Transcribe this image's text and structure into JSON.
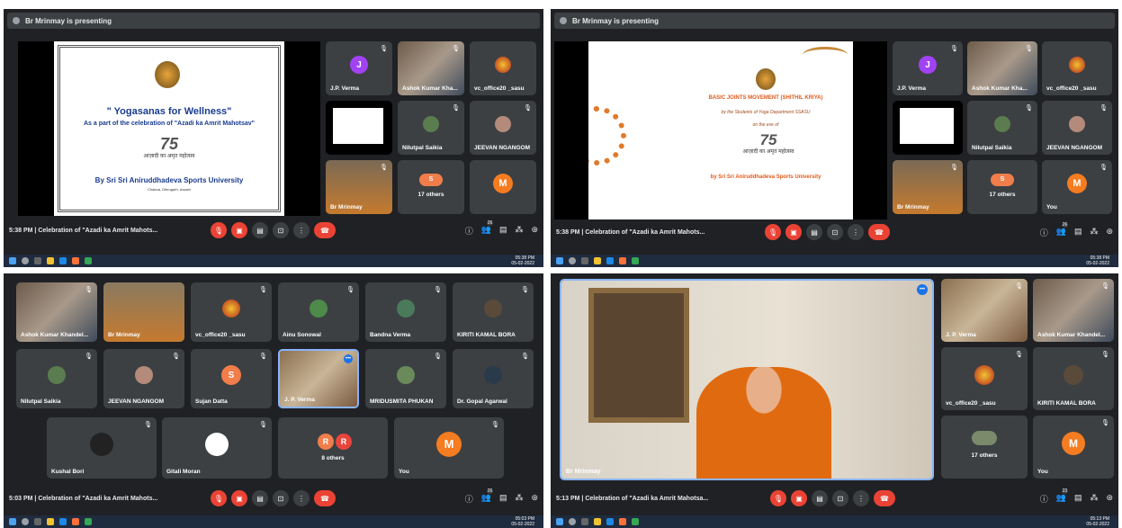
{
  "panel_a": {
    "presenting": "Br Mrinmay is presenting",
    "slide": {
      "title": "\" Yogasanas for Wellness\"",
      "subtitle": "As a part of the celebration of \"Azadi ka Amrit Mahotsav\"",
      "logo_num": "75",
      "hindi": "आज़ादी का अमृत महोत्सव",
      "org": "By Sri Sri Aniruddhadeva Sports University",
      "place": "Chabua, Dibrugarh, Assam"
    },
    "tiles": [
      "J.P. Verma",
      "Ashok Kumar Kha...",
      "vc_office20 _sasu",
      "Nilutpal Saikia",
      "JEEVAN NGANGOM",
      "Br Mrinmay",
      "17 others",
      ""
    ],
    "avatar_j": "J",
    "avatar_m": "M",
    "avatar_s": "S",
    "time": "5:38 PM",
    "meeting": "Celebration of \"Azadi ka Amrit Mahots...",
    "count": "26",
    "clock_time": "05:38 PM",
    "clock_date": "05-02-2022"
  },
  "panel_b": {
    "presenting": "Br Mrinmay is presenting",
    "slide": {
      "title": "BASIC JOINTS MOVEMENT (SHITHIL KRIYA)",
      "line2": "by the Students of Yoga Department SSASU",
      "line3": "on the eve of",
      "logo_num": "75",
      "hindi": "आज़ादी का अमृत महोत्सव",
      "org": "by Sri Sri Aniruddhadeva Sports University"
    },
    "tiles": [
      "J.P. Verma",
      "Ashok Kumar Kha...",
      "vc_office20 _sasu",
      "Nilutpal Saikia",
      "JEEVAN NGANGOM",
      "Br Mrinmay",
      "17 others",
      "You"
    ],
    "avatar_j": "J",
    "avatar_m": "M",
    "avatar_s": "S",
    "time": "5:38 PM",
    "meeting": "Celebration of \"Azadi ka Amrit Mahots...",
    "count": "26",
    "clock_time": "05:38 PM",
    "clock_date": "05-02-2022"
  },
  "panel_c": {
    "tiles": [
      "Ashok Kumar Khandel...",
      "Br Mrinmay",
      "vc_office20 _sasu",
      "Ainu Sonowal",
      "Bandna Verma",
      "KIRITI KAMAL BORA",
      "Nilutpal Saikia",
      "JEEVAN NGANGOM",
      "Sujan Datta",
      "J. P. Verma",
      "MRIDUSMITA PHUKAN",
      "Dr. Gopal Agarwal",
      "Kushal Bori",
      "Gitali Moran",
      "8 others",
      "You"
    ],
    "avatar_s": "S",
    "avatar_r1": "R",
    "avatar_r2": "R",
    "avatar_m": "M",
    "time": "5:03 PM",
    "meeting": "Celebration of \"Azadi ka Amrit Mahots...",
    "count": "26",
    "clock_time": "05:03 PM",
    "clock_date": "05-02-2022"
  },
  "panel_d": {
    "main_name": "Br Mrinmay",
    "tiles": [
      "J. P. Verma",
      "Ashok Kumar Khandel...",
      "vc_office20 _sasu",
      "KIRITI KAMAL BORA",
      "17 others",
      "You"
    ],
    "avatar_m": "M",
    "time": "5:13 PM",
    "meeting": "Celebration of \"Azadi ka Amrit Mahotsa...",
    "count": "23",
    "clock_time": "05:13 PM",
    "clock_date": "05-02-2022"
  }
}
